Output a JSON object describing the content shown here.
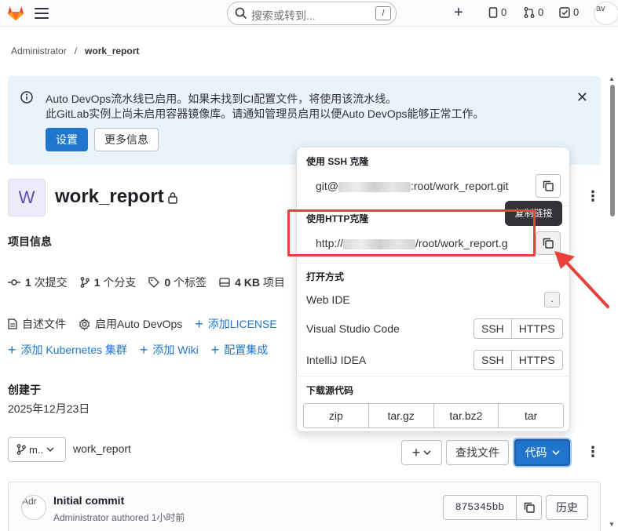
{
  "topbar": {
    "search_placeholder": "搜索或转到...",
    "search_shortcut": "/",
    "issues_count": "0",
    "mr_count": "0",
    "todo_count": "0",
    "avatar_alt": "av"
  },
  "breadcrumb": {
    "parent": "Administrator",
    "separator": "/",
    "current": "work_report"
  },
  "alert": {
    "line1": "Auto DevOps流水线已启用。如果未找到CI配置文件，将使用该流水线。",
    "line2": "此GitLab实例上尚未启用容器镜像库。请通知管理员启用以便Auto DevOps能够正常工作。",
    "primary_label": "设置",
    "secondary_label": "更多信息"
  },
  "project": {
    "avatar_letter": "W",
    "name": "work_report",
    "info_title": "项目信息",
    "stats": [
      {
        "count": "1",
        "label": " 次提交"
      },
      {
        "count": "1",
        "label": " 个分支"
      },
      {
        "count": "0",
        "label": " 个标签"
      },
      {
        "count": "4 KB",
        "label": " 项目"
      }
    ],
    "links_row1": [
      "自述文件",
      "启用Auto DevOps",
      "添加LICENSE"
    ],
    "links_row2": [
      "添加 Kubernetes 集群",
      "添加 Wiki",
      "配置集成"
    ],
    "created_label": "创建于",
    "created_date": "2025年12月23日"
  },
  "repo_toolbar": {
    "branch": "m..",
    "repo_name": "work_report",
    "add_label": "+",
    "find_file_label": "查找文件",
    "code_label": "代码"
  },
  "commit": {
    "avatar_alt": "Adr",
    "title": "Initial commit",
    "meta": "Administrator authored 1小时前",
    "sha": "875345bb",
    "history_label": "历史"
  },
  "clone_dropdown": {
    "ssh_title": "使用 SSH 克隆",
    "ssh_prefix": "git@",
    "ssh_suffix": ":root/work_report.git",
    "http_title": "使用HTTP克隆",
    "http_prefix": "http://",
    "http_suffix": "/root/work_report.g",
    "tooltip": "复制链接",
    "open_title": "打开方式",
    "web_ide": "Web IDE",
    "web_ide_key": ".",
    "vscode": "Visual Studio Code",
    "intellij": "IntelliJ IDEA",
    "ssh_btn": "SSH",
    "https_btn": "HTTPS",
    "download_title": "下载源代码",
    "formats": [
      "zip",
      "tar.gz",
      "tar.bz2",
      "tar"
    ]
  },
  "colors": {
    "primary": "#1f75cb",
    "alert_bg": "#e9f3fc",
    "highlight": "#e8413b"
  }
}
